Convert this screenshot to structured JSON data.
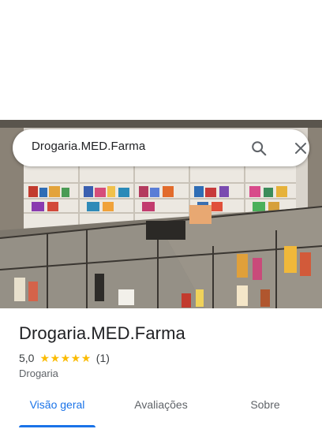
{
  "search": {
    "query": "Drogaria.MED.Farma"
  },
  "icons": {
    "search": "search-icon",
    "close": "close-icon"
  },
  "place": {
    "name": "Drogaria.MED.Farma",
    "rating": "5,0",
    "stars_filled": 5,
    "review_count": "(1)",
    "category": "Drogaria"
  },
  "tabs": [
    {
      "label": "Visão geral",
      "active": true
    },
    {
      "label": "Avaliações",
      "active": false
    },
    {
      "label": "Sobre",
      "active": false
    }
  ],
  "colors": {
    "accent": "#1a73e8",
    "star": "#fbbc04",
    "text_primary": "#202124",
    "text_secondary": "#5f6368"
  }
}
